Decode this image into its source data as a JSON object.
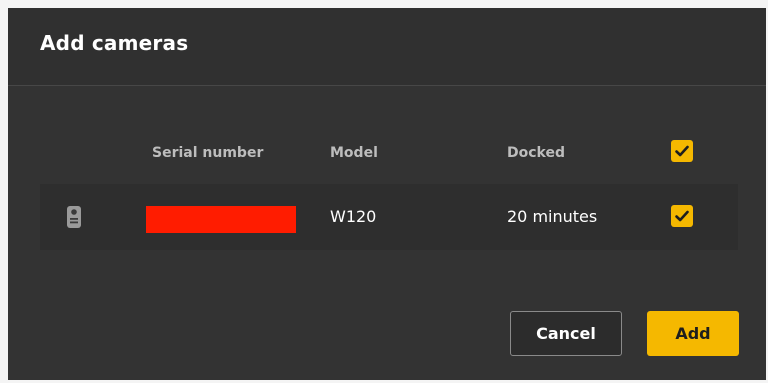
{
  "dialog": {
    "title": "Add cameras"
  },
  "table": {
    "headers": {
      "serial": "Serial number",
      "model": "Model",
      "docked": "Docked"
    },
    "select_all_checked": true,
    "rows": [
      {
        "icon": "body-camera-icon",
        "serial_redacted": true,
        "model": "W120",
        "docked": "20 minutes",
        "checked": true
      }
    ]
  },
  "buttons": {
    "cancel": "Cancel",
    "add": "Add"
  },
  "colors": {
    "accent": "#f5b800",
    "dialog_bg": "#333333",
    "redaction": "#ff1c00"
  }
}
